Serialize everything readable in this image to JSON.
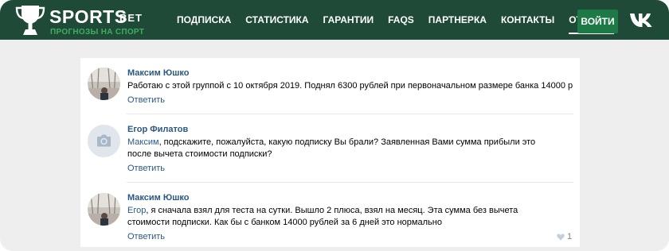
{
  "logo": {
    "name": "SPORTS",
    "suffix": "BET",
    "tagline": "ПРОГНОЗЫ НА СПОРТ"
  },
  "nav": {
    "items": [
      {
        "label": "ПОДПИСКА"
      },
      {
        "label": "СТАТИСТИКА"
      },
      {
        "label": "ГАРАНТИИ"
      },
      {
        "label": "FAQS"
      },
      {
        "label": "ПАРТНЕРКА"
      },
      {
        "label": "КОНТАКТЫ"
      },
      {
        "label": "ОТЗЫВЫ",
        "active": true
      }
    ],
    "login_label": "ВОЙТИ",
    "social_icon": "vk-icon"
  },
  "comments": [
    {
      "author": "Максим Юшко",
      "mention": "",
      "text": "Работаю с этой группой с 10 октября 2019. Поднял 6300 рублей при первоначальном размере банка 14000 р",
      "reply_label": "Ответить",
      "avatar": "photo"
    },
    {
      "author": "Егор Филатов",
      "mention": "Максим",
      "text": ", подскажите, пожалуйста, какую подписку Вы брали? Заявленная Вами сумма прибыли это после вычета стоимости подписки?",
      "reply_label": "Ответить",
      "avatar": "camera-placeholder-icon"
    },
    {
      "author": "Максим Юшко",
      "mention": "Егор",
      "text": ", я сначала взял для теста на сутки. Вышло 2 плюса, взял на месяц. Эта сумма без вычета стоимости подписки. Как бы с банком 14000 рублей за 6 дней это нормально",
      "reply_label": "Ответить",
      "avatar": "photo",
      "likes": "1"
    }
  ],
  "colors": {
    "header_bg": "#1f4a37",
    "login_bg": "#1d7a46",
    "tagline": "#3fae5f",
    "link": "#2a5885",
    "page_bg": "#eeeeee"
  }
}
